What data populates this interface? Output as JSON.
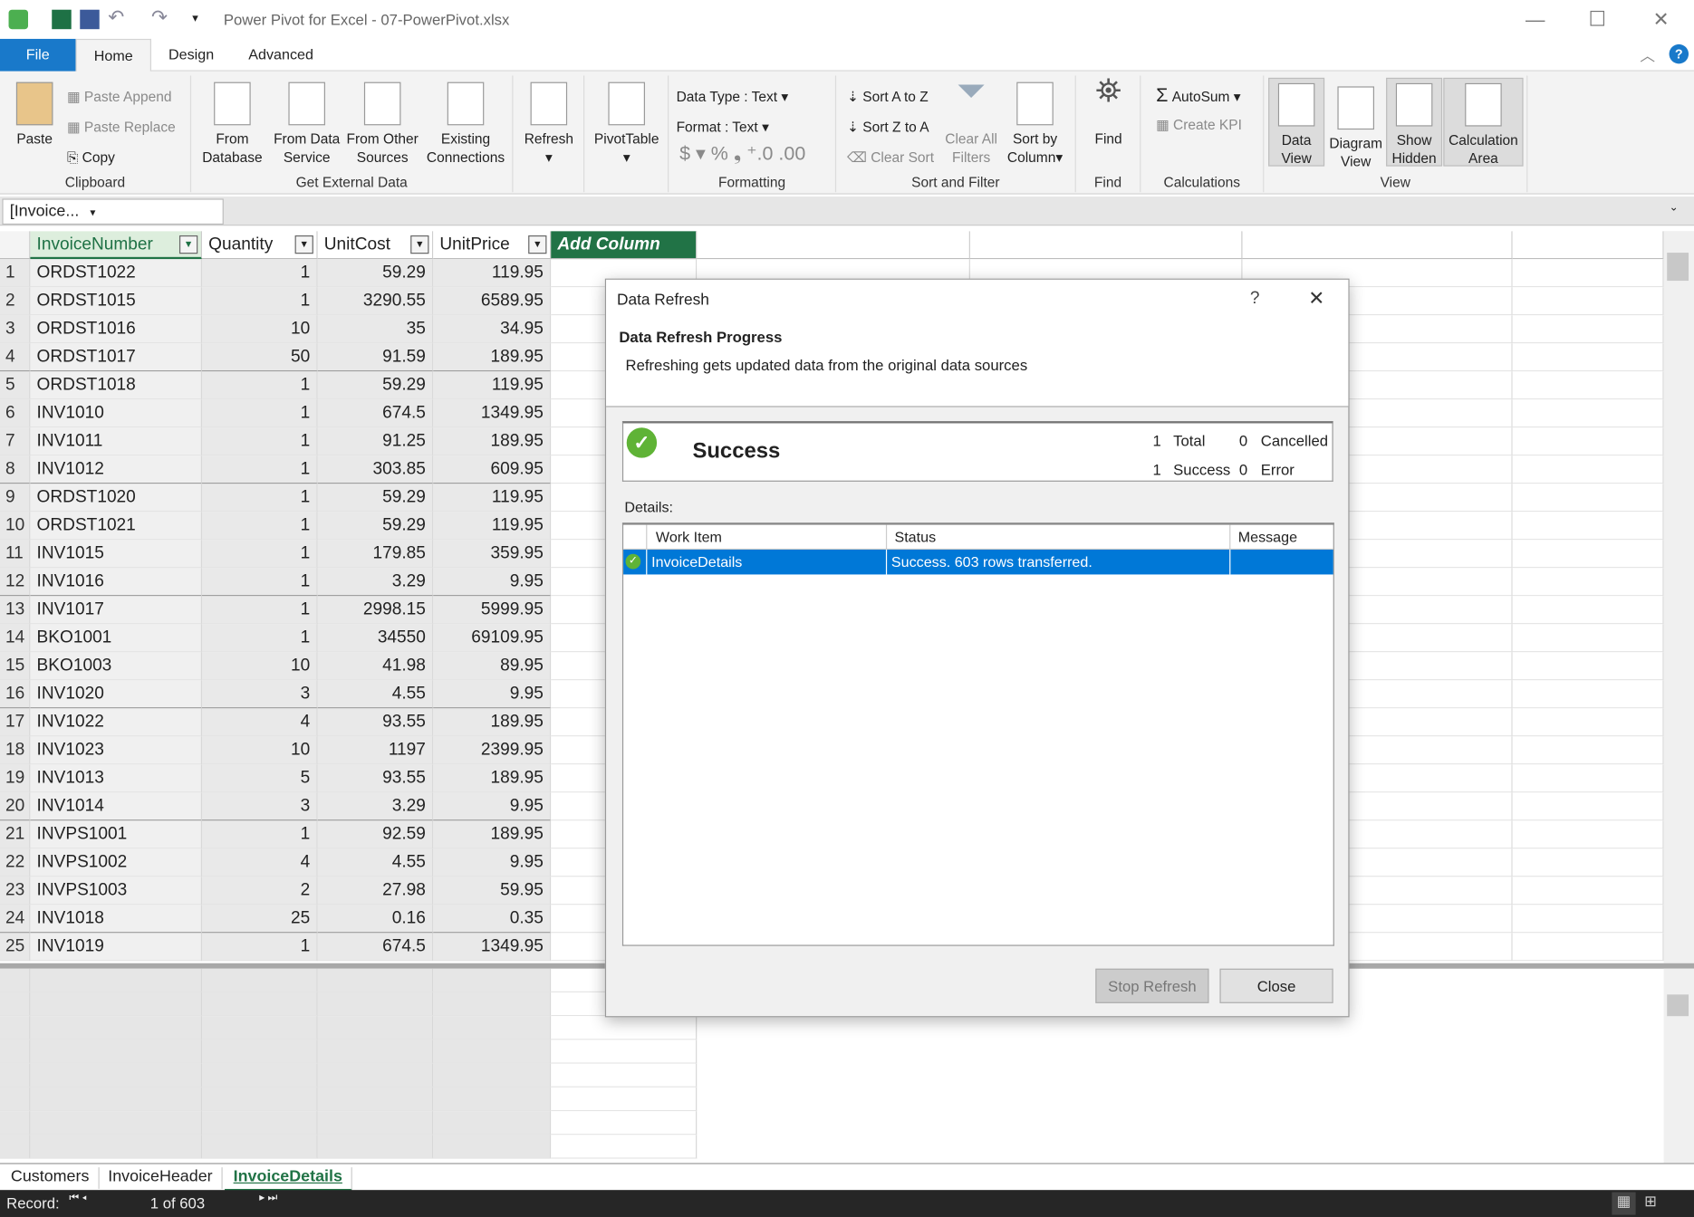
{
  "app": {
    "title": "Power Pivot for Excel - 07-PowerPivot.xlsx"
  },
  "tabs": [
    {
      "label": "File"
    },
    {
      "label": "Home"
    },
    {
      "label": "Design"
    },
    {
      "label": "Advanced"
    }
  ],
  "ribbon": {
    "clipboard": {
      "label": "Clipboard",
      "paste": "Paste",
      "paste_append": "Paste Append",
      "paste_replace": "Paste Replace",
      "copy": "Copy"
    },
    "external": {
      "label": "Get External Data",
      "from_database": [
        "From",
        "Database"
      ],
      "from_data_service": [
        "From Data",
        "Service"
      ],
      "from_other": [
        "From Other",
        "Sources"
      ],
      "existing": [
        "Existing",
        "Connections"
      ]
    },
    "refresh": "Refresh",
    "pivottable": "PivotTable",
    "formatting": {
      "label": "Formatting",
      "data_type": "Data Type : Text",
      "format": "Format : Text"
    },
    "sort": {
      "label": "Sort and Filter",
      "a_to_z": "Sort A to Z",
      "z_to_a": "Sort Z to A",
      "clear_sort": "Clear Sort",
      "clear_all": [
        "Clear All",
        "Filters"
      ],
      "sort_by": [
        "Sort by",
        "Column"
      ]
    },
    "find": {
      "label": "Find",
      "button": "Find"
    },
    "calc": {
      "label": "Calculations",
      "autosum": "AutoSum",
      "create_kpi": "Create KPI"
    },
    "view": {
      "label": "View",
      "data_view": [
        "Data",
        "View"
      ],
      "diagram": [
        "Diagram",
        "View"
      ],
      "show_hidden": [
        "Show",
        "Hidden"
      ],
      "calc_area": [
        "Calculation",
        "Area"
      ]
    }
  },
  "namebox": "[Invoice...",
  "grid": {
    "columns": [
      "InvoiceNumber",
      "Quantity",
      "UnitCost",
      "UnitPrice",
      "Add Column"
    ],
    "rows": [
      [
        "ORDST1022",
        "1",
        "59.29",
        "119.95"
      ],
      [
        "ORDST1015",
        "1",
        "3290.55",
        "6589.95"
      ],
      [
        "ORDST1016",
        "10",
        "35",
        "34.95"
      ],
      [
        "ORDST1017",
        "50",
        "91.59",
        "189.95"
      ],
      [
        "ORDST1018",
        "1",
        "59.29",
        "119.95"
      ],
      [
        "INV1010",
        "1",
        "674.5",
        "1349.95"
      ],
      [
        "INV1011",
        "1",
        "91.25",
        "189.95"
      ],
      [
        "INV1012",
        "1",
        "303.85",
        "609.95"
      ],
      [
        "ORDST1020",
        "1",
        "59.29",
        "119.95"
      ],
      [
        "ORDST1021",
        "1",
        "59.29",
        "119.95"
      ],
      [
        "INV1015",
        "1",
        "179.85",
        "359.95"
      ],
      [
        "INV1016",
        "1",
        "3.29",
        "9.95"
      ],
      [
        "INV1017",
        "1",
        "2998.15",
        "5999.95"
      ],
      [
        "BKO1001",
        "1",
        "34550",
        "69109.95"
      ],
      [
        "BKO1003",
        "10",
        "41.98",
        "89.95"
      ],
      [
        "INV1020",
        "3",
        "4.55",
        "9.95"
      ],
      [
        "INV1022",
        "4",
        "93.55",
        "189.95"
      ],
      [
        "INV1023",
        "10",
        "1197",
        "2399.95"
      ],
      [
        "INV1013",
        "5",
        "93.55",
        "189.95"
      ],
      [
        "INV1014",
        "3",
        "3.29",
        "9.95"
      ],
      [
        "INVPS1001",
        "1",
        "92.59",
        "189.95"
      ],
      [
        "INVPS1002",
        "4",
        "4.55",
        "9.95"
      ],
      [
        "INVPS1003",
        "2",
        "27.98",
        "59.95"
      ],
      [
        "INV1018",
        "25",
        "0.16",
        "0.35"
      ],
      [
        "INV1019",
        "1",
        "674.5",
        "1349.95"
      ]
    ]
  },
  "dialog": {
    "title": "Data Refresh",
    "help": "?",
    "heading": "Data Refresh Progress",
    "description": "Refreshing gets updated data from the original data sources",
    "result": "Success",
    "counts": {
      "total": "1",
      "total_label": "Total",
      "cancelled": "0",
      "cancelled_label": "Cancelled",
      "success": "1",
      "success_label": "Success",
      "error": "0",
      "error_label": "Error"
    },
    "details_label": "Details:",
    "table": {
      "headers": [
        "Work Item",
        "Status",
        "Message"
      ],
      "rows": [
        [
          "InvoiceDetails",
          "Success. 603 rows transferred.",
          ""
        ]
      ]
    },
    "stop_refresh": "Stop Refresh",
    "close": "Close"
  },
  "sheets": [
    {
      "label": "Customers"
    },
    {
      "label": "InvoiceHeader"
    },
    {
      "label": "InvoiceDetails",
      "active": true
    }
  ],
  "status": {
    "record_label": "Record:",
    "record": "1 of 603"
  },
  "colors": {
    "accent": "#217346",
    "file_tab": "#1979ca",
    "selection": "#0078d7"
  }
}
